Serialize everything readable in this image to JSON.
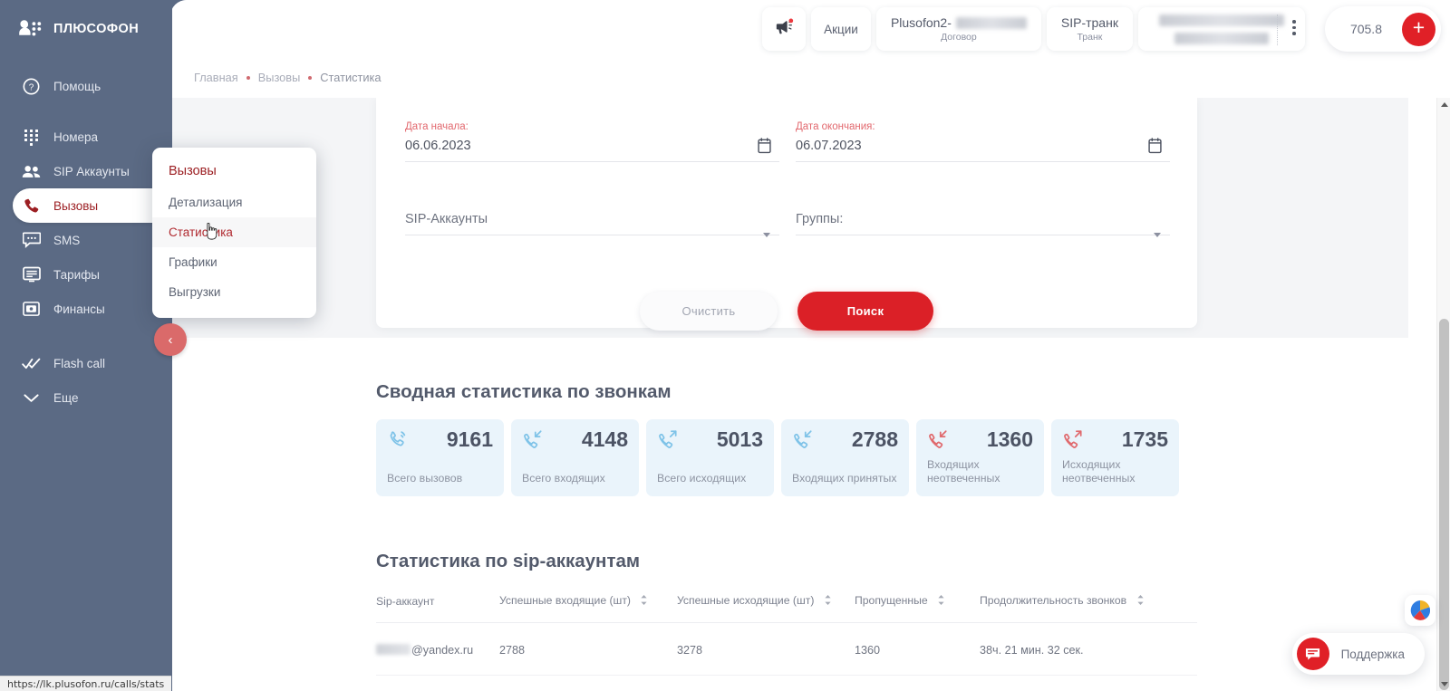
{
  "brand": {
    "name": "ПЛЮСОФОН",
    "icon": "plusofon-logo-icon"
  },
  "sidebar": {
    "items": [
      {
        "label": "Помощь",
        "icon": "help-circle-icon",
        "active": false
      },
      {
        "label": "Номера",
        "icon": "dialpad-icon",
        "active": false
      },
      {
        "label": "SIP Аккаунты",
        "icon": "users-icon",
        "active": false
      },
      {
        "label": "Вызовы",
        "icon": "phone-icon",
        "active": true
      },
      {
        "label": "SMS",
        "icon": "chat-bubble-icon",
        "active": false
      },
      {
        "label": "Тарифы",
        "icon": "card-list-icon",
        "active": false
      },
      {
        "label": "Финансы",
        "icon": "wallet-icon",
        "active": false
      },
      {
        "label": "Flash call",
        "icon": "double-check-icon",
        "active": false
      },
      {
        "label": "Еще",
        "icon": "chevron-down-icon",
        "active": false
      }
    ],
    "collapse_button": "‹"
  },
  "submenu": {
    "title": "Вызовы",
    "items": [
      {
        "label": "Детализация",
        "current": false
      },
      {
        "label": "Статистика",
        "current": true
      },
      {
        "label": "Графики",
        "current": false
      },
      {
        "label": "Выгрузки",
        "current": false
      }
    ]
  },
  "topbar": {
    "megaphone_icon": "megaphone-icon",
    "promo_label": "Акции",
    "contract": {
      "title": "Plusofon2-",
      "subtitle": "Договор",
      "redacted": true
    },
    "trunk": {
      "title": "SIP-транк",
      "subtitle": "Транк"
    },
    "account": {
      "redacted": true
    },
    "kebab_icon": "more-vertical-icon",
    "balance": {
      "value": "705.8",
      "add_label": "+"
    }
  },
  "breadcrumb": [
    {
      "label": "Главная"
    },
    {
      "label": "Вызовы"
    },
    {
      "label": "Статистика"
    }
  ],
  "filters": {
    "date_start": {
      "label": "Дата начала:",
      "value": "06.06.2023",
      "icon": "calendar-icon"
    },
    "date_end": {
      "label": "Дата окончания:",
      "value": "06.07.2023",
      "icon": "calendar-icon"
    },
    "sip_accounts": {
      "value": "SIP-Аккаунты"
    },
    "groups": {
      "value": "Группы:"
    },
    "clear_button": "Очистить",
    "search_button": "Поиск"
  },
  "summary": {
    "title": "Сводная статистика по звонкам",
    "cards": [
      {
        "value": "9161",
        "label": "Всего вызовов",
        "icon": "phone-ring-icon",
        "color": "#7fc3e8"
      },
      {
        "value": "4148",
        "label": "Всего входящих",
        "icon": "phone-incoming-icon",
        "color": "#7fc3e8"
      },
      {
        "value": "5013",
        "label": "Всего исходящих",
        "icon": "phone-outgoing-icon",
        "color": "#7fc3e8"
      },
      {
        "value": "2788",
        "label": "Входящих принятых",
        "icon": "phone-incoming-icon",
        "color": "#7fc3e8"
      },
      {
        "value": "1360",
        "label": "Входящих неотвеченных",
        "icon": "phone-incoming-icon",
        "color": "#e06a6e"
      },
      {
        "value": "1735",
        "label": "Исходящих неотвеченных",
        "icon": "phone-outgoing-icon",
        "color": "#e06a6e"
      }
    ]
  },
  "sip_table": {
    "title": "Статистика по sip-аккаунтам",
    "columns": [
      {
        "label": "Sip-аккаунт",
        "sortable": false
      },
      {
        "label": "Успешные входящие (шт)",
        "sortable": true
      },
      {
        "label": "Успешные исходящие (шт)",
        "sortable": true
      },
      {
        "label": "Пропущенные",
        "sortable": true
      },
      {
        "label": "Продолжительность звонков",
        "sortable": true
      }
    ],
    "rows": [
      {
        "account": "@yandex.ru",
        "account_redacted": true,
        "incoming": "2788",
        "outgoing": "3278",
        "missed": "1360",
        "duration": "38ч. 21 мин. 32 сек."
      }
    ]
  },
  "support": {
    "label": "Поддержка",
    "icon": "chat-support-icon"
  },
  "lang_badge": {
    "icon": "color-wheel-icon"
  },
  "statusbar": {
    "url": "https://lk.plusofon.ru/calls/stats"
  },
  "colors": {
    "sidebar_bg": "#5b6a84",
    "accent_red": "#db2027",
    "brand_dark_red": "#9c1f23",
    "stat_card_bg": "#eaf4fb",
    "blue_icon": "#7fc3e8",
    "red_icon": "#e06a6e"
  }
}
